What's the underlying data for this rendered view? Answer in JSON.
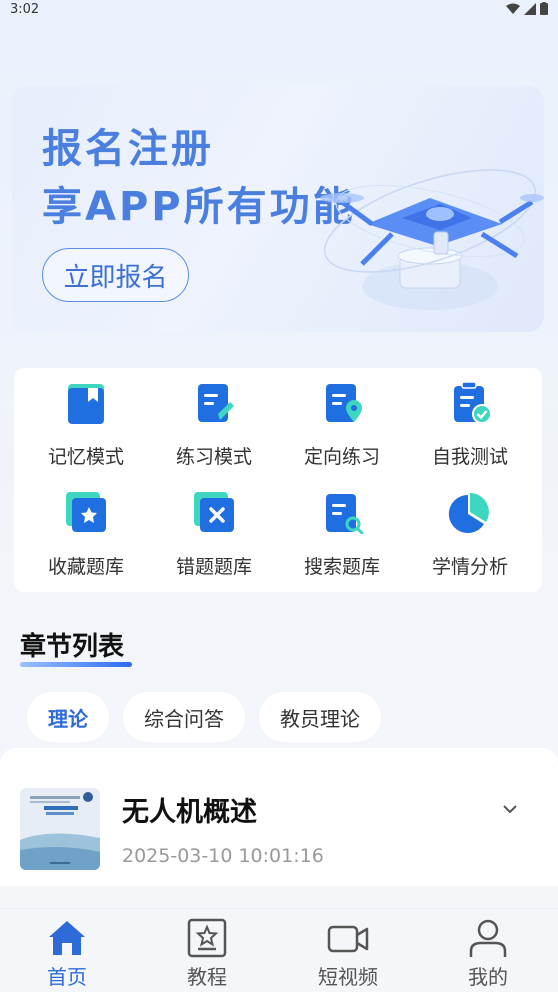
{
  "status_bar": {
    "time": "3:02"
  },
  "banner": {
    "title_line1": "报名注册",
    "title_line2": "享APP所有功能",
    "button_label": "立即报名"
  },
  "functions": [
    {
      "label": "记忆模式",
      "icon": "bookmark-book-icon"
    },
    {
      "label": "练习模式",
      "icon": "edit-document-icon"
    },
    {
      "label": "定向练习",
      "icon": "location-document-icon"
    },
    {
      "label": "自我测试",
      "icon": "checklist-icon"
    },
    {
      "label": "收藏题库",
      "icon": "star-card-icon"
    },
    {
      "label": "错题题库",
      "icon": "wrong-card-icon"
    },
    {
      "label": "搜索题库",
      "icon": "search-document-icon"
    },
    {
      "label": "学情分析",
      "icon": "pie-chart-icon"
    }
  ],
  "chapter_section": {
    "title": "章节列表",
    "tabs": [
      {
        "label": "理论",
        "active": true
      },
      {
        "label": "综合问答",
        "active": false
      },
      {
        "label": "教员理论",
        "active": false
      }
    ],
    "items": [
      {
        "title": "无人机概述",
        "timestamp": "2025-03-10 10:01:16"
      }
    ]
  },
  "bottom_nav": [
    {
      "label": "首页",
      "icon": "home-icon",
      "active": true
    },
    {
      "label": "教程",
      "icon": "tutorial-icon",
      "active": false
    },
    {
      "label": "短视频",
      "icon": "video-icon",
      "active": false
    },
    {
      "label": "我的",
      "icon": "user-icon",
      "active": false
    }
  ],
  "colors": {
    "accent": "#2f6bd8",
    "icon_blue": "#1f6fe0",
    "icon_teal": "#3dd6c0"
  }
}
